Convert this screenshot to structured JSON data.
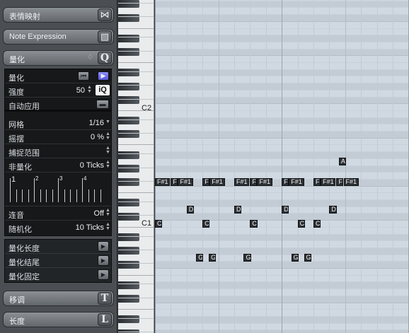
{
  "inspector": {
    "sections": {
      "expression_map": {
        "label": "表情映射",
        "icon": "expression-map-icon"
      },
      "note_expression": {
        "label": "Note Expression",
        "icon": "note-expression-icon"
      },
      "quantize": {
        "label": "量化",
        "icon_letter": "Q"
      },
      "transpose": {
        "label": "移调",
        "icon_letter": "T"
      },
      "length": {
        "label": "长度",
        "icon_letter": "L"
      }
    },
    "quantize": {
      "quantize_label": "量化",
      "strength_label": "强度",
      "strength_value": "50",
      "iq_label": "iQ",
      "auto_apply_label": "自动应用",
      "grid_label": "网格",
      "grid_value": "1/16",
      "swing_label": "摇摆",
      "swing_value": "0 %",
      "catch_range_label": "捕捉范围",
      "non_quantize_label": "非量化",
      "non_quantize_value": "0 Ticks",
      "lane_numbers": [
        "1",
        "2",
        "3",
        "4"
      ],
      "tuplet_label": "连音",
      "tuplet_value": "Off",
      "randomize_label": "随机化",
      "randomize_value": "10 Ticks"
    },
    "actions": {
      "quantize_length": "量化长度",
      "quantize_ends": "量化结尾",
      "freeze_quantize": "量化固定"
    }
  },
  "keyboard": {
    "labels": {
      "c2": "C2",
      "c1": "C1"
    }
  },
  "notes": [
    {
      "pitch": "F#1",
      "label": "F#1",
      "pos16": 0,
      "len16": 1
    },
    {
      "pitch": "F#1",
      "label": "F",
      "pos16": 1,
      "len16": 0.45
    },
    {
      "pitch": "F#1",
      "label": "F#1",
      "pos16": 1.45,
      "len16": 1
    },
    {
      "pitch": "F#1",
      "label": "F",
      "pos16": 3,
      "len16": 0.45
    },
    {
      "pitch": "F#1",
      "label": "F#1",
      "pos16": 3.45,
      "len16": 1
    },
    {
      "pitch": "F#1",
      "label": "F#1",
      "pos16": 5,
      "len16": 1
    },
    {
      "pitch": "F#1",
      "label": "F",
      "pos16": 6,
      "len16": 0.45
    },
    {
      "pitch": "F#1",
      "label": "F#1",
      "pos16": 6.45,
      "len16": 1
    },
    {
      "pitch": "F#1",
      "label": "F",
      "pos16": 8,
      "len16": 0.45
    },
    {
      "pitch": "F#1",
      "label": "F#1",
      "pos16": 8.45,
      "len16": 1
    },
    {
      "pitch": "F#1",
      "label": "F",
      "pos16": 10,
      "len16": 0.45
    },
    {
      "pitch": "F#1",
      "label": "F#1",
      "pos16": 10.45,
      "len16": 1
    },
    {
      "pitch": "F#1",
      "label": "F",
      "pos16": 11.45,
      "len16": 0.45
    },
    {
      "pitch": "F#1",
      "label": "F#1",
      "pos16": 11.9,
      "len16": 1
    },
    {
      "pitch": "D1",
      "label": "D",
      "pos16": 2,
      "len16": 0.5
    },
    {
      "pitch": "D1",
      "label": "D",
      "pos16": 5,
      "len16": 0.5
    },
    {
      "pitch": "D1",
      "label": "D",
      "pos16": 8,
      "len16": 0.5
    },
    {
      "pitch": "D1",
      "label": "D",
      "pos16": 11,
      "len16": 0.5
    },
    {
      "pitch": "C1",
      "label": "C",
      "pos16": 0,
      "len16": 0.5
    },
    {
      "pitch": "C1",
      "label": "C",
      "pos16": 3,
      "len16": 0.5
    },
    {
      "pitch": "C1",
      "label": "C",
      "pos16": 6,
      "len16": 0.5
    },
    {
      "pitch": "C1",
      "label": "C",
      "pos16": 9,
      "len16": 0.5
    },
    {
      "pitch": "C1",
      "label": "C",
      "pos16": 10,
      "len16": 0.5
    },
    {
      "pitch": "G0",
      "label": "G",
      "pos16": 2.6,
      "len16": 0.5
    },
    {
      "pitch": "G0",
      "label": "G",
      "pos16": 3.4,
      "len16": 0.5
    },
    {
      "pitch": "G0",
      "label": "G",
      "pos16": 5.6,
      "len16": 0.5
    },
    {
      "pitch": "G0",
      "label": "G",
      "pos16": 8.6,
      "len16": 0.5
    },
    {
      "pitch": "G0",
      "label": "G",
      "pos16": 9.4,
      "len16": 0.5
    },
    {
      "pitch": "A1",
      "label": "A",
      "pos16": 11.6,
      "len16": 0.5
    }
  ]
}
